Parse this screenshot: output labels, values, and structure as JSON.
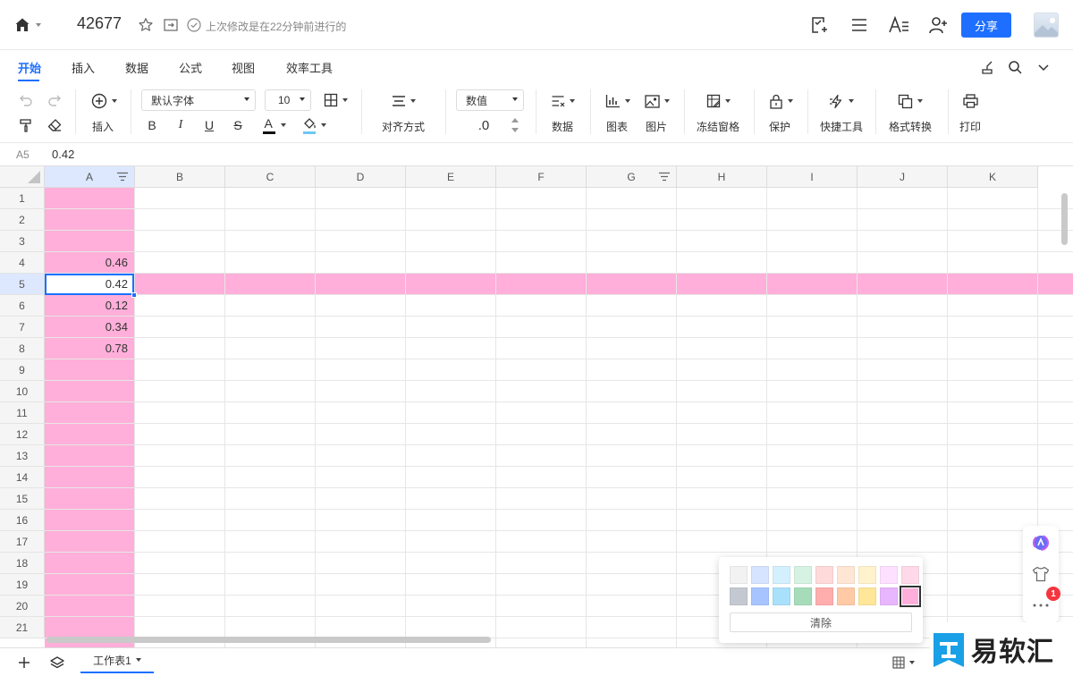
{
  "header": {
    "doc_title": "42677",
    "saved_status": "上次修改是在22分钟前进行的",
    "share_label": "分享"
  },
  "menu": {
    "tabs": [
      "开始",
      "插入",
      "数据",
      "公式",
      "视图",
      "效率工具"
    ],
    "active_tab": "开始"
  },
  "toolbar": {
    "insert_label": "插入",
    "font_name": "默认字体",
    "font_size": "10",
    "bold": "B",
    "italic": "I",
    "underline": "U",
    "strike": "S",
    "font_color_glyph": "A",
    "align_label": "对齐方式",
    "number_format": "数值",
    "decimal": ".0",
    "data_label": "数据",
    "chart_label": "图表",
    "image_label": "图片",
    "freeze_label": "冻结窗格",
    "protect_label": "保护",
    "quicktools_label": "快捷工具",
    "convert_label": "格式转换",
    "print_label": "打印"
  },
  "formula_bar": {
    "cell_ref": "A5",
    "value": "0.42"
  },
  "grid": {
    "columns": [
      "A",
      "B",
      "C",
      "D",
      "E",
      "F",
      "G",
      "H",
      "I",
      "J",
      "K"
    ],
    "rows": [
      "1",
      "2",
      "3",
      "4",
      "5",
      "6",
      "7",
      "8",
      "9",
      "10",
      "11",
      "12",
      "13",
      "14",
      "15",
      "16",
      "17",
      "18",
      "19",
      "20",
      "21"
    ],
    "cells": {
      "A4": "0.46",
      "A5": "0.42",
      "A6": "0.12",
      "A7": "0.34",
      "A8": "0.78"
    },
    "highlight_color": "#ffafd9",
    "selected_cell": "A5"
  },
  "bottom": {
    "sheet_tab": "工作表1"
  },
  "palette": {
    "row1": [
      "#f2f2f2",
      "#d6e4ff",
      "#d4f0ff",
      "#d6f2e2",
      "#ffdada",
      "#ffe6d4",
      "#fff2cc",
      "#fde0ff",
      "#ffd9e8"
    ],
    "row2": [
      "#c4c8d0",
      "#a7c4ff",
      "#a9e0fb",
      "#a6dcb9",
      "#ffadad",
      "#ffcaa5",
      "#ffe699",
      "#e8b6ff",
      "#ffafd9"
    ],
    "selected_color": "#ffafd9",
    "clear_label": "清除"
  },
  "float_panel": {
    "badge_count": "1"
  },
  "watermark": {
    "text": "易软汇"
  }
}
